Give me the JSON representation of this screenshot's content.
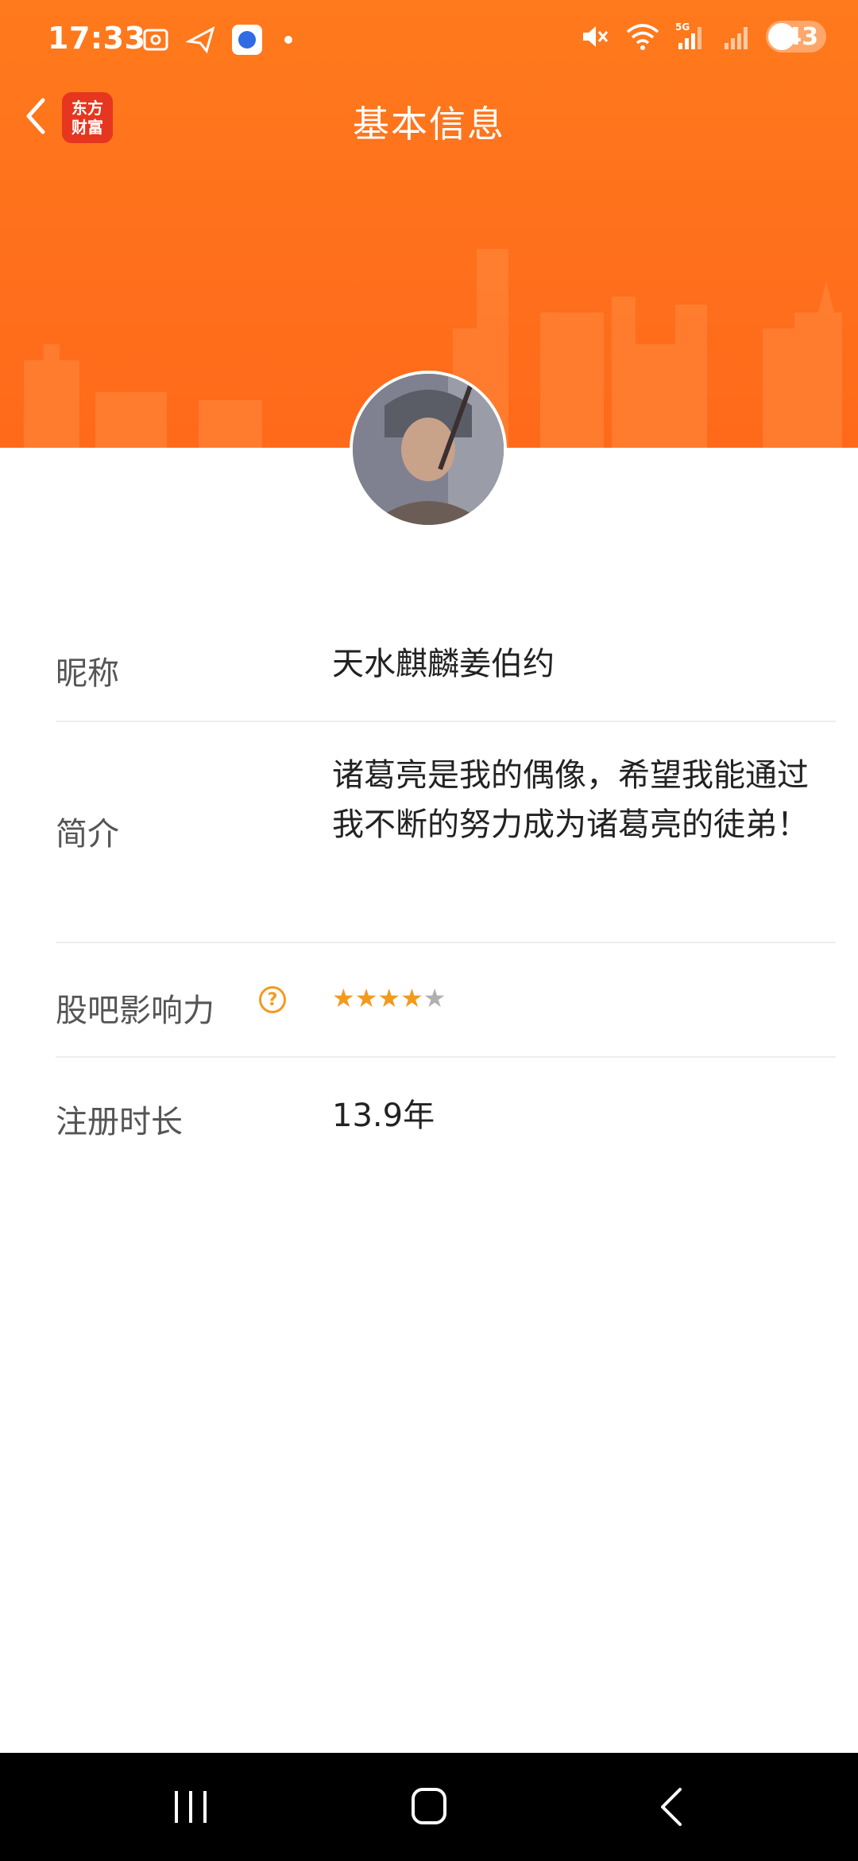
{
  "status_bar": {
    "time": "17:33",
    "battery": "43",
    "icons_left": [
      "screenshot-icon",
      "paper-plane-icon",
      "baidu-app-icon",
      "dot-icon"
    ],
    "icons_right": [
      "mute-icon",
      "wifi-icon",
      "5g-signal-icon",
      "signal-icon",
      "battery-icon"
    ]
  },
  "header": {
    "title": "基本信息",
    "logo_line1": "东方",
    "logo_line2": "财富",
    "background_color": "#ff6f1c"
  },
  "profile": {
    "rows": {
      "nickname": {
        "label": "昵称",
        "value": "天水麒麟姜伯约"
      },
      "bio": {
        "label": "简介",
        "value": "诸葛亮是我的偶像，希望我能通过我不断的努力成为诸葛亮的徒弟！"
      },
      "influence": {
        "label": "股吧影响力",
        "help": "?",
        "rating": 4,
        "max_rating": 5
      },
      "registered": {
        "label": "注册时长",
        "value": "13.9年"
      }
    }
  },
  "colors": {
    "accent": "#f39a1e",
    "header_orange": "#ff6f1c",
    "divider": "#ededed"
  }
}
